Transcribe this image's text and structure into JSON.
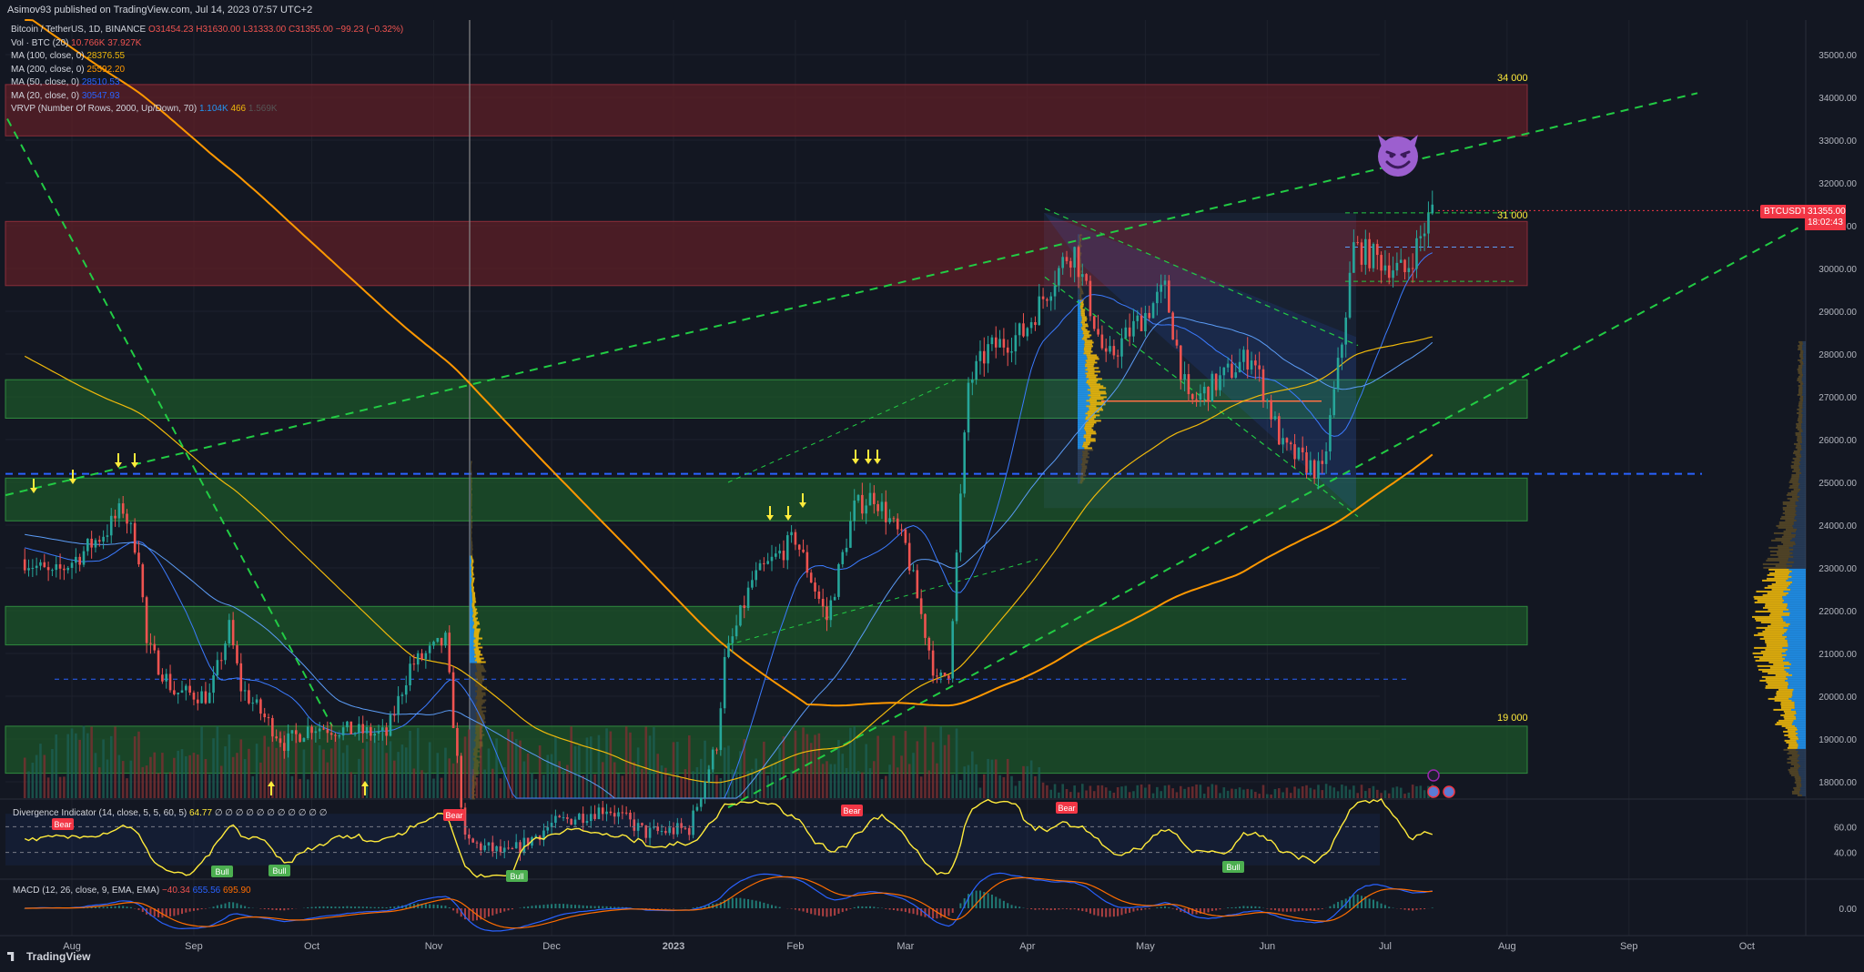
{
  "header": {
    "text": "Asimov93 published on TradingView.com, Jul 14, 2023 07:57 UTC+2"
  },
  "legend": {
    "main": {
      "label": "Bitcoin / TetherUS, 1D, BINANCE",
      "ohlc": "O31454.23 H31630.00 L31333.00 C31355.00 −99.23 (−0.32%)"
    },
    "vol": {
      "label": "Vol · BTC (20)",
      "v1": "10.766K",
      "v2": "37.927K"
    },
    "ma100": {
      "label": "MA (100, close, 0)",
      "value": "28376.55"
    },
    "ma200": {
      "label": "MA (200, close, 0)",
      "value": "25592.20"
    },
    "ma50": {
      "label": "MA (50, close, 0)",
      "value": "28510.53"
    },
    "ma20": {
      "label": "MA (20, close, 0)",
      "value": "30547.93"
    },
    "vrvp": {
      "label": "VRVP (Number Of Rows, 2000, Up/Down, 70)",
      "v1": "1.104K",
      "v2": "466",
      "v3": "1.569K"
    }
  },
  "badges": {
    "symbol": "BTCUSDT",
    "price": "31355.00",
    "countdown": "18:02:43"
  },
  "level_labels": {
    "l34": "34 000",
    "l31": "31 000",
    "l19": "19 000"
  },
  "markers": {
    "bear": "Bear",
    "bull": "Bull"
  },
  "oscillators": {
    "divergence": {
      "label": "Divergence Indicator (14, close, 5, 5, 60, 5)",
      "value": "64.77",
      "tail": "∅ ∅ ∅ ∅ ∅ ∅ ∅ ∅ ∅ ∅ ∅"
    },
    "macd": {
      "label": "MACD (12, 26, close, 9, EMA, EMA)",
      "v1": "−40.34",
      "v2": "655.56",
      "v3": "695.90"
    }
  },
  "footer": {
    "brand": "TradingView"
  },
  "colors": {
    "bg": "#131722",
    "up": "#26a69a",
    "down": "#ef5350",
    "ma100": "#f0b90b",
    "ma200": "#ff9800",
    "ma50": "#2962ff",
    "resistance": "#5d1f27",
    "support": "#1d5a2a",
    "trend": "#22cc44"
  },
  "chart_data": {
    "type": "candlestick",
    "title": "Bitcoin / TetherUS, 1D, BINANCE",
    "x_ticks": [
      "Aug",
      "Sep",
      "Oct",
      "Nov",
      "Dec",
      "2023",
      "Feb",
      "Mar",
      "Apr",
      "May",
      "Jun",
      "Jul",
      "Aug",
      "Sep",
      "Oct"
    ],
    "y_ticks": [
      "35000.00",
      "34000.00",
      "33000.00",
      "32000.00",
      "31000.00",
      "30000.00",
      "29000.00",
      "28000.00",
      "27000.00",
      "26000.00",
      "25000.00",
      "24000.00",
      "23000.00",
      "22000.00",
      "21000.00",
      "20000.00",
      "19000.00",
      "18000.00"
    ],
    "ylim": [
      17600,
      35400
    ],
    "grid": true,
    "last_price": 31355.0,
    "resistance_zones": [
      [
        33100,
        34300
      ],
      [
        29600,
        31100
      ]
    ],
    "support_zones": [
      [
        26500,
        27400
      ],
      [
        24100,
        25100
      ],
      [
        21200,
        22100
      ],
      [
        18200,
        19300
      ]
    ],
    "horizontal_line": 25200,
    "close_path": [
      [
        "2022-07-20",
        23200
      ],
      [
        "2022-07-27",
        22800
      ],
      [
        "2022-08-03",
        23300
      ],
      [
        "2022-08-10",
        23900
      ],
      [
        "2022-08-14",
        24400
      ],
      [
        "2022-08-18",
        23300
      ],
      [
        "2022-08-20",
        21200
      ],
      [
        "2022-08-27",
        20100
      ],
      [
        "2022-09-05",
        20000
      ],
      [
        "2022-09-10",
        21600
      ],
      [
        "2022-09-13",
        20200
      ],
      [
        "2022-09-19",
        19500
      ],
      [
        "2022-09-24",
        18900
      ],
      [
        "2022-10-01",
        19300
      ],
      [
        "2022-10-10",
        19200
      ],
      [
        "2022-10-20",
        19100
      ],
      [
        "2022-10-26",
        20700
      ],
      [
        "2022-11-04",
        21300
      ],
      [
        "2022-11-09",
        16600
      ],
      [
        "2022-11-20",
        16300
      ],
      [
        "2022-12-01",
        17000
      ],
      [
        "2022-12-15",
        17400
      ],
      [
        "2022-12-25",
        16800
      ],
      [
        "2023-01-05",
        16900
      ],
      [
        "2023-01-12",
        18900
      ],
      [
        "2023-01-14",
        20800
      ],
      [
        "2023-01-21",
        22700
      ],
      [
        "2023-02-01",
        23700
      ],
      [
        "2023-02-09",
        21800
      ],
      [
        "2023-02-16",
        24400
      ],
      [
        "2023-02-21",
        24700
      ],
      [
        "2023-03-01",
        23500
      ],
      [
        "2023-03-09",
        20300
      ],
      [
        "2023-03-12",
        20600
      ],
      [
        "2023-03-17",
        27300
      ],
      [
        "2023-03-22",
        28100
      ],
      [
        "2023-03-31",
        28500
      ],
      [
        "2023-04-11",
        30300
      ],
      [
        "2023-04-13",
        30400
      ],
      [
        "2023-04-21",
        27800
      ],
      [
        "2023-04-26",
        28400
      ],
      [
        "2023-05-06",
        29500
      ],
      [
        "2023-05-12",
        26800
      ],
      [
        "2023-05-28",
        28000
      ],
      [
        "2023-06-05",
        25800
      ],
      [
        "2023-06-15",
        25200
      ],
      [
        "2023-06-20",
        28300
      ],
      [
        "2023-06-23",
        30500
      ],
      [
        "2023-07-06",
        29900
      ],
      [
        "2023-07-13",
        31355
      ]
    ],
    "moving_averages": [
      {
        "name": "MA (20, close, 0)",
        "value": 30547.93
      },
      {
        "name": "MA (50, close, 0)",
        "value": 28510.53
      },
      {
        "name": "MA (100, close, 0)",
        "value": 28376.55
      },
      {
        "name": "MA (200, close, 0)",
        "value": 25592.2
      }
    ],
    "volume_profile_value_area": [
      20000,
      23000
    ],
    "divergence_indicator": {
      "value": 64.77,
      "levels": [
        40,
        60
      ],
      "ticks": [
        "60.00",
        "40.00"
      ]
    },
    "macd": {
      "macd": -40.34,
      "signal": 655.56,
      "hist": 695.9,
      "ticks": [
        "0.00"
      ]
    }
  }
}
